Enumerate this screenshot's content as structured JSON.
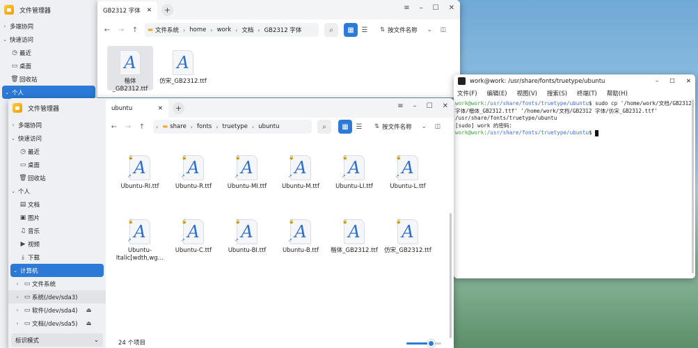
{
  "back_window": {
    "app_title": "文件管理器",
    "tab_title": "GB2312 字体",
    "sidebar": {
      "collab": "多端协同",
      "quick": "快速访问",
      "recent": "最近",
      "desktop": "桌面",
      "trash": "回收站",
      "personal": "个人"
    },
    "crumbs": [
      "文件系统",
      "home",
      "work",
      "文档",
      "GB2312 字体"
    ],
    "sort_label": "按文件名称",
    "files": [
      "楷体_GB2312.ttf",
      "仿宋_GB2312.ttf"
    ]
  },
  "front_window": {
    "app_title": "文件管理器",
    "tab_title": "ubuntu",
    "sidebar": {
      "collab": "多端协同",
      "quick": "快速访问",
      "recent": "最近",
      "desktop": "桌面",
      "trash": "回收站",
      "personal": "个人",
      "docs": "文档",
      "pics": "图片",
      "music": "音乐",
      "video": "视频",
      "downloads": "下载",
      "computer": "计算机",
      "fs": "文件系统",
      "sys": "系统(/dev/sda3)",
      "soft": "软件(/dev/sda4)",
      "docdisk": "文档(/dev/sda5)",
      "mode": "标识模式"
    },
    "crumbs": [
      "share",
      "fonts",
      "truetype",
      "ubuntu"
    ],
    "sort_label": "按文件名称",
    "files_row1": [
      "Ubuntu-RI.ttf",
      "Ubuntu-R.ttf",
      "Ubuntu-MI.ttf",
      "Ubuntu-M.ttf",
      "Ubuntu-LI.ttf",
      "Ubuntu-L.ttf"
    ],
    "files_row2": [
      "Ubuntu-\nItalic[wdth,wg…",
      "Ubuntu-C.ttf",
      "Ubuntu-BI.ttf",
      "Ubuntu-B.ttf",
      "楷体_GB2312.ttf",
      "仿宋_GB2312.ttf"
    ],
    "status": "24 个项目",
    "zoom_level": 0.7
  },
  "terminal": {
    "title": "work@work: /usr/share/fonts/truetype/ubuntu",
    "menu": [
      "文件(F)",
      "编辑(E)",
      "视图(V)",
      "搜索(S)",
      "终端(T)",
      "帮助(H)"
    ],
    "line1_user": "work@work",
    "line1_path": ":/usr/share/fonts/truetype/ubuntu",
    "line1_cmd": "$ sudo cp '/home/work/文档/GB2312 字体/楷体_GB2312.ttf' '/home/work/文档/GB2312 字体/仿宋_GB2312.ttf' /usr/share/fonts/truetype/ubuntu",
    "line2": "[sudo] work 的密码：",
    "line3_user": "work@work",
    "line3_path": ":/usr/share/fonts/truetype/ubuntu",
    "line3_prompt": "$ "
  },
  "glyph": "A"
}
